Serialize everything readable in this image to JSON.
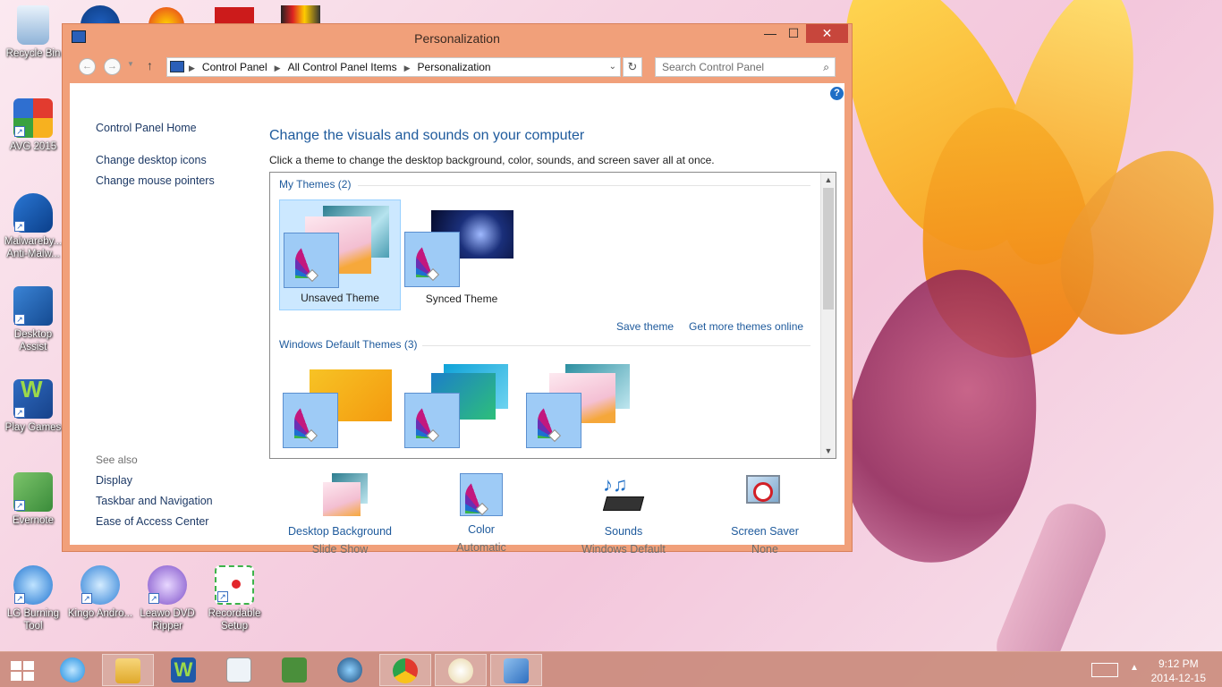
{
  "desktop": {
    "icons": [
      {
        "label": "Recycle Bin",
        "icon": "recycle-bin-icon"
      },
      {
        "label": "AVG 2015",
        "icon": "avg-icon"
      },
      {
        "label": "Malwareby... Anti-Malw...",
        "icon": "malwarebytes-icon"
      },
      {
        "label": "Desktop Assist",
        "icon": "desktop-assist-icon"
      },
      {
        "label": "Play Games",
        "icon": "play-games-icon"
      },
      {
        "label": "Evernote",
        "icon": "evernote-icon"
      },
      {
        "label": "LG Burning Tool",
        "icon": "lg-burning-icon"
      },
      {
        "label": "Kingo Andro...",
        "icon": "kingo-icon"
      },
      {
        "label": "Leawo DVD Ripper",
        "icon": "leawo-icon"
      },
      {
        "label": "Recordable Setup",
        "icon": "recordable-icon"
      }
    ]
  },
  "window": {
    "title": "Personalization",
    "controls": {
      "minimize": "—",
      "maximize": "☐",
      "close": "✕"
    },
    "breadcrumbs": [
      "Control Panel",
      "All Control Panel Items",
      "Personalization"
    ],
    "search": {
      "placeholder": "Search Control Panel"
    },
    "help": "?"
  },
  "sidebar": {
    "links": [
      "Control Panel Home",
      "Change desktop icons",
      "Change mouse pointers"
    ],
    "see_also_title": "See also",
    "see_also": [
      "Display",
      "Taskbar and Navigation",
      "Ease of Access Center"
    ]
  },
  "main": {
    "heading": "Change the visuals and sounds on your computer",
    "subtext": "Click a theme to change the desktop background, color, sounds, and screen saver all at once.",
    "my_themes_header": "My Themes (2)",
    "my_themes": [
      {
        "label": "Unsaved Theme",
        "selected": true
      },
      {
        "label": "Synced Theme",
        "selected": false
      }
    ],
    "save_theme": "Save theme",
    "get_more": "Get more themes online",
    "default_themes_header": "Windows Default Themes (3)"
  },
  "settings": [
    {
      "name": "Desktop Background",
      "value": "Slide Show",
      "icon": "desktop-background-icon"
    },
    {
      "name": "Color",
      "value": "Automatic",
      "icon": "color-palette-icon"
    },
    {
      "name": "Sounds",
      "value": "Windows Default",
      "icon": "sounds-icon"
    },
    {
      "name": "Screen Saver",
      "value": "None",
      "icon": "screen-saver-icon"
    }
  ],
  "taskbar": {
    "time": "9:12 PM",
    "date": "2014-12-15"
  },
  "colors": {
    "window_frame": "#f1a07a",
    "link_blue": "#1e5a9c",
    "close_red": "#c7463c"
  }
}
